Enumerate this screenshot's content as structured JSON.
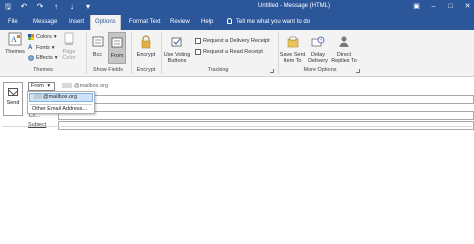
{
  "window": {
    "title": "Untitled  -  Message (HTML)"
  },
  "quick_access": [
    "save-icon",
    "undo-icon",
    "redo-icon",
    "up-arrow-icon",
    "down-arrow-icon",
    "customize-icon"
  ],
  "tabs": [
    {
      "label": "File",
      "active": false
    },
    {
      "label": "Message",
      "active": false
    },
    {
      "label": "Insert",
      "active": false
    },
    {
      "label": "Options",
      "active": true
    },
    {
      "label": "Format Text",
      "active": false
    },
    {
      "label": "Review",
      "active": false
    },
    {
      "label": "Help",
      "active": false
    }
  ],
  "tell_me": "Tell me what you want to do",
  "ribbon": {
    "themes": {
      "themes_label": "Themes",
      "colors_label": "Colors",
      "fonts_label": "Fonts",
      "effects_label": "Effects",
      "page_color_label": "Page\nColor",
      "group_label": "Themes"
    },
    "show_fields": {
      "bcc_label": "Bcc",
      "from_label": "From",
      "group_label": "Show Fields"
    },
    "encrypt": {
      "encrypt_label": "Encrypt",
      "group_label": "Encrypt"
    },
    "tracking": {
      "voting_label": "Use Voting\nButtons",
      "delivery_receipt_label": "Request a Delivery Receipt",
      "read_receipt_label": "Request a Read Receipt",
      "group_label": "Tracking"
    },
    "more_options": {
      "save_sent_label": "Save Sent\nItem To",
      "delay_delivery_label": "Delay\nDelivery",
      "direct_replies_label": "Direct\nReplies To",
      "group_label": "More Options"
    }
  },
  "compose": {
    "send_label": "Send",
    "from_button_label": "From",
    "from_value": "@mailbox.org",
    "cc_label": "Cc...",
    "subject_label": "Subject",
    "dropdown": {
      "account_item": "@mailbox.org",
      "other_item": "Other Email Address..."
    }
  },
  "colors": {
    "brand": "#2b579a",
    "ribbon_bg": "#f3f3f3",
    "highlight": "#cde3f7"
  }
}
